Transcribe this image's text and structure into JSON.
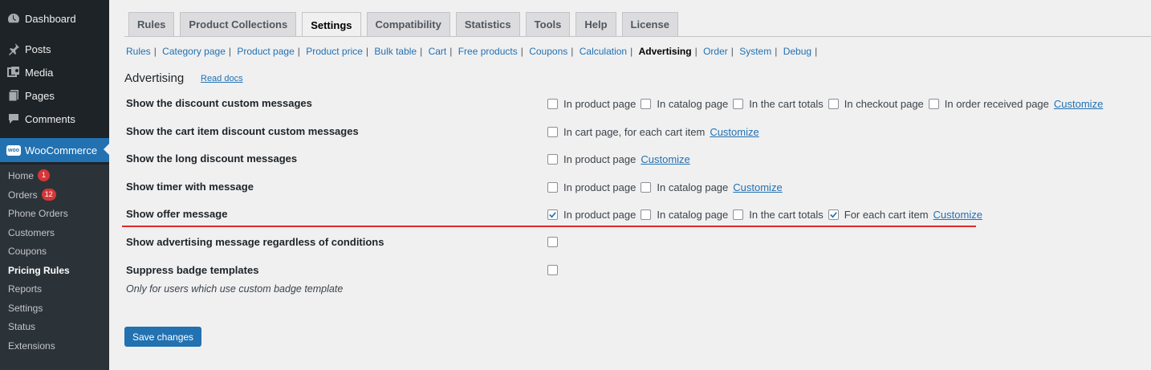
{
  "sidebar": {
    "dashboard": "Dashboard",
    "posts": "Posts",
    "media": "Media",
    "pages": "Pages",
    "comments": "Comments",
    "woocommerce": "WooCommerce",
    "woo_logo_text": "woo",
    "sub": {
      "home": "Home",
      "home_count": "1",
      "orders": "Orders",
      "orders_count": "12",
      "phone_orders": "Phone Orders",
      "customers": "Customers",
      "coupons": "Coupons",
      "pricing_rules": "Pricing Rules",
      "reports": "Reports",
      "settings": "Settings",
      "status": "Status",
      "extensions": "Extensions"
    }
  },
  "tabs": [
    "Rules",
    "Product Collections",
    "Settings",
    "Compatibility",
    "Statistics",
    "Tools",
    "Help",
    "License"
  ],
  "subnav": [
    "Rules",
    "Category page",
    "Product page",
    "Product price",
    "Bulk table",
    "Cart",
    "Free products",
    "Coupons",
    "Calculation",
    "Advertising",
    "Order",
    "System",
    "Debug"
  ],
  "section": {
    "title": "Advertising",
    "read_docs": "Read docs"
  },
  "rows": [
    {
      "label": "Show the discount custom messages",
      "options": [
        {
          "label": "In product page",
          "checked": false
        },
        {
          "label": "In catalog page",
          "checked": false
        },
        {
          "label": "In the cart totals",
          "checked": false
        },
        {
          "label": "In checkout page",
          "checked": false
        },
        {
          "label": "In order received page",
          "checked": false
        }
      ],
      "customize": "Customize"
    },
    {
      "label": "Show the cart item discount custom messages",
      "options": [
        {
          "label": "In cart page, for each cart item",
          "checked": false
        }
      ],
      "customize": "Customize"
    },
    {
      "label": "Show the long discount messages",
      "options": [
        {
          "label": "In product page",
          "checked": false
        }
      ],
      "customize": "Customize"
    },
    {
      "label": "Show timer with message",
      "options": [
        {
          "label": "In product page",
          "checked": false
        },
        {
          "label": "In catalog page",
          "checked": false
        }
      ],
      "customize": "Customize"
    },
    {
      "label": "Show offer message",
      "options": [
        {
          "label": "In product page",
          "checked": true
        },
        {
          "label": "In catalog page",
          "checked": false
        },
        {
          "label": "In the cart totals",
          "checked": false
        },
        {
          "label": "For each cart item",
          "checked": true
        }
      ],
      "customize": "Customize"
    },
    {
      "label": "Show advertising message regardless of conditions",
      "checked": false
    },
    {
      "label": "Suppress badge templates",
      "checked": false,
      "description": "Only for users which use custom badge template"
    }
  ],
  "save_label": "Save changes",
  "colors": {
    "accent": "#2271b1",
    "sidebar": "#1d2327",
    "submenu": "#2c3338",
    "highlight_line": "#e02b27",
    "badge": "#d63638"
  }
}
